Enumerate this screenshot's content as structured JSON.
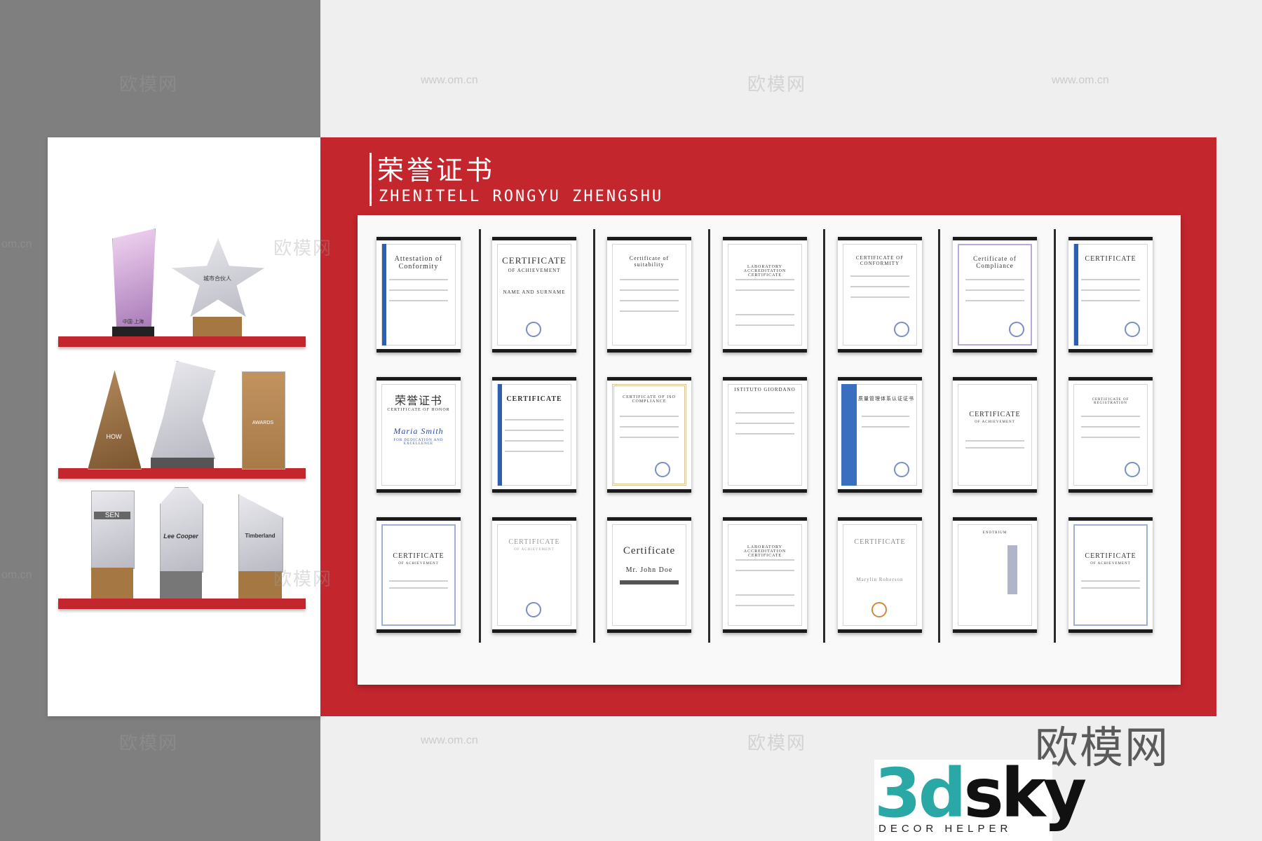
{
  "title_cn": "荣誉证书",
  "title_en": "ZHENITELL RONGYU ZHENGSHU",
  "watermarks": {
    "brand": "欧模网",
    "url": "www.om.cn",
    "url_short": "om.cn"
  },
  "logo": {
    "part1": "3d",
    "part2": "sky",
    "tagline": "DECOR HELPER"
  },
  "certificates": [
    {
      "title": "Attestation of Conformity"
    },
    {
      "title": "CERTIFICATE",
      "subtitle": "OF ACHIEVEMENT",
      "name": "NAME AND SURNAME"
    },
    {
      "title": "Certificate of suitability"
    },
    {
      "title": "LABORATORY ACCREDITATION CERTIFICATE"
    },
    {
      "title": "CERTIFICATE OF CONFORMITY"
    },
    {
      "title": "Certificate of Compliance"
    },
    {
      "title": "CERTIFICATE"
    },
    {
      "title": "荣誉证书",
      "subtitle": "CERTIFICATE OF HONOR",
      "name": "Maria Smith",
      "note": "FOR DEDICATION AND EXCELLENCE"
    },
    {
      "title": "CERTIFICATE"
    },
    {
      "title": "CERTIFICATE OF ISO COMPLIANCE"
    },
    {
      "title": "ISTITUTO GIORDANO"
    },
    {
      "title": "质量管理体系认证证书"
    },
    {
      "title": "CERTIFICATE",
      "subtitle": "OF ACHIEVEMENT"
    },
    {
      "title": "CERTIFICATE OF REGISTRATION"
    },
    {
      "title": "CERTIFICATE",
      "subtitle": "OF ACHIEVEMENT"
    },
    {
      "title": "CERTIFICATE",
      "subtitle": "OF ACHIEVEMENT"
    },
    {
      "title": "Certificate",
      "name": "Mr. John Doe"
    },
    {
      "title": "LABORATORY ACCREDITATION CERTIFICATE"
    },
    {
      "title": "CERTIFICATE",
      "name": "Marylin Roberson"
    },
    {
      "title": "ENOTRIUM"
    },
    {
      "title": "CERTIFICATE",
      "subtitle": "OF ACHIEVEMENT"
    }
  ],
  "trophies": [
    {
      "label": "中国·上海"
    },
    {
      "label": "城市合伙人"
    },
    {
      "label": "HOW"
    },
    {
      "label": "AWARDS"
    },
    {
      "label": "SEN"
    },
    {
      "label": "Lee Cooper"
    },
    {
      "label": "Timberland"
    }
  ]
}
